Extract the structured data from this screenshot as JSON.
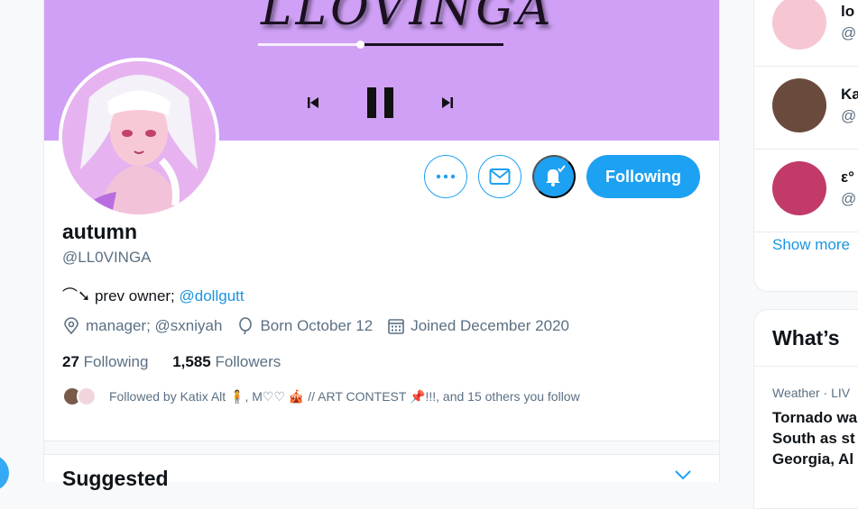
{
  "banner": {
    "logo_text": "LLOVINGA",
    "progress": 0.42,
    "controls": [
      "previous-icon",
      "pause-icon",
      "next-icon"
    ]
  },
  "profile": {
    "name": "autumn",
    "handle": "@LL0VINGA",
    "bio_prefix": "⌒➘ prev owner; ",
    "bio_link": "@dollgutt",
    "meta": {
      "manager": "manager; @sxniyah",
      "birthday": "Born October 12",
      "joined": "Joined December 2020"
    },
    "following_count": "27",
    "following_label": "Following",
    "followers_count": "1,585",
    "followers_label": "Followers",
    "followed_by": "Followed by Katix Alt 🧍, M♡♡ 🎪 // ART CONTEST 📌!!!, and 15 others you follow"
  },
  "actions": {
    "more_icon": "more-icon",
    "message_icon": "mail-icon",
    "notify_icon": "bell-icon",
    "follow_label": "Following"
  },
  "suggested": {
    "title": "Suggested"
  },
  "sidebar": {
    "who_to_follow": [
      {
        "name": "lo",
        "handle": "@"
      },
      {
        "name": "Ka",
        "handle": "@"
      },
      {
        "name": "ε°",
        "handle": "@"
      }
    ],
    "show_more": "Show more",
    "trends_title": "What’s",
    "trend": {
      "meta": "Weather · LIV",
      "text_lines": [
        "Tornado wa",
        "South as st",
        "Georgia, Al"
      ]
    }
  },
  "colors": {
    "accent": "#1da1f2",
    "banner": "#cfa0f6",
    "muted": "#5b7083"
  }
}
